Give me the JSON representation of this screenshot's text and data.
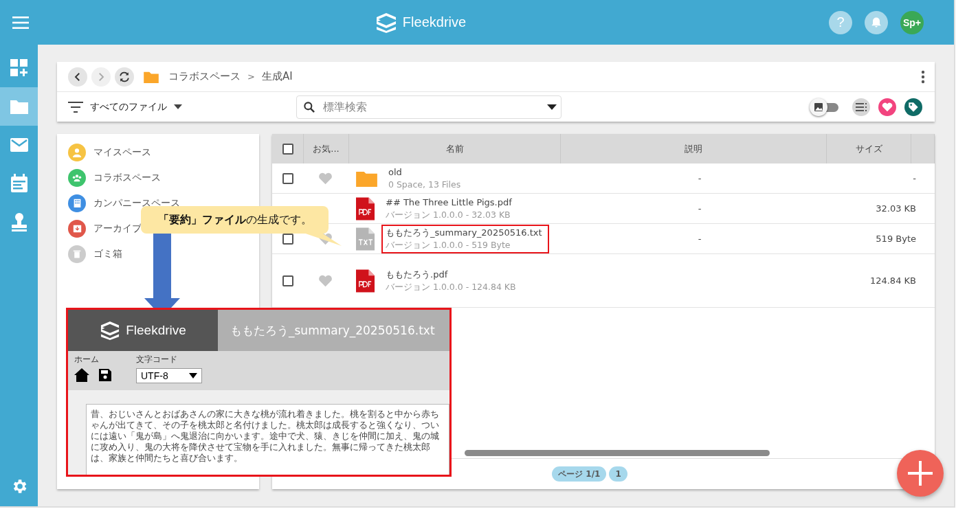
{
  "header": {
    "logo": "Fleekdrive",
    "help": "?",
    "avatar": "Sp+"
  },
  "rail": [
    {
      "kind": "dashboard",
      "selected": false
    },
    {
      "kind": "folder",
      "selected": true
    },
    {
      "kind": "mail",
      "selected": false
    },
    {
      "kind": "calendar",
      "selected": false
    },
    {
      "kind": "stamp",
      "selected": false
    }
  ],
  "toolbar": {
    "breadcrumb": [
      "コラボスペース",
      "生成AI"
    ],
    "separator": ">",
    "filter": "すべてのファイル",
    "search": {
      "placeholder": "標準検索"
    },
    "thumbnail_toggle": {
      "on": false
    }
  },
  "sidebar": {
    "items": [
      {
        "label": "マイスペース",
        "kind": "person",
        "color": "#f6c343"
      },
      {
        "label": "コラボスペース",
        "kind": "group",
        "color": "#3ec46d"
      },
      {
        "label": "カンパニースペース",
        "kind": "building",
        "color": "#3f8fe2"
      },
      {
        "label": "アーカイブ",
        "kind": "archive",
        "color": "#e0574a"
      },
      {
        "label": "ゴミ箱",
        "kind": "trash",
        "color": "#cccccc"
      }
    ]
  },
  "table": {
    "select_all_checked": false,
    "columns": [
      "お気...",
      "名前",
      "説明",
      "サイズ"
    ],
    "rows": [
      {
        "kind": "folder",
        "name": "old",
        "meta": "0 Space, 13 Files",
        "description": "-",
        "size": "-",
        "checked": false,
        "favorite": false,
        "highlighted": false
      },
      {
        "kind": "pdf",
        "name": "## The Three Little Pigs.pdf",
        "meta": "バージョン 1.0.0.0 - 32.03 KB",
        "description": "-",
        "size": "32.03 KB",
        "highlighted": false
      },
      {
        "kind": "txt",
        "name": "ももたろう_summary_20250516.txt",
        "meta": "バージョン 1.0.0.0 - 519 Byte",
        "description": "-",
        "size": "519 Byte",
        "checked": false,
        "favorite": false,
        "highlighted": true
      },
      {
        "kind": "pdf",
        "name": "ももたろう.pdf",
        "meta": "バージョン 1.0.0.0 - 124.84 KB",
        "description": "",
        "size": "124.84 KB",
        "checked": false,
        "favorite": false,
        "highlighted": false
      }
    ]
  },
  "pagination": {
    "label": "ページ 1/1",
    "pages": [
      {
        "label": "1",
        "selected": true
      }
    ]
  },
  "callout": {
    "text": "**「要約」ファイル**の生成です。"
  },
  "editor": {
    "logo": "Fleekdrive",
    "filename": "ももたろう_summary_20250516.txt",
    "home_label": "ホーム",
    "encoding_label": "文字コード",
    "encoding": "UTF-8",
    "content": "昔、おじいさんとおばあさんの家に大きな桃が流れ着きました。桃を割ると中から赤ちゃんが出てきて、その子を桃太郎と名付けました。桃太郎は成長すると強くなり、ついには遠い「鬼が島」へ鬼退治に向かいます。途中で犬、猿、きじを仲間に加え、鬼の城に攻め入り、鬼の大将を降伏させて宝物を手に入れました。無事に帰ってきた桃太郎は、家族と仲間たちと喜び合います。"
  }
}
